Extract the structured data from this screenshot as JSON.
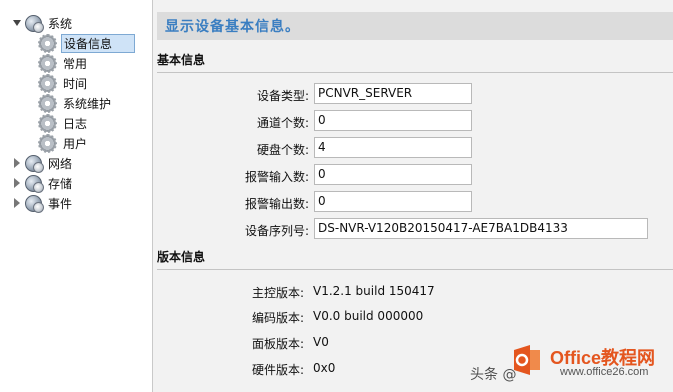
{
  "sidebar": {
    "root_system": "系统",
    "system_children": [
      "设备信息",
      "常用",
      "时间",
      "系统维护",
      "日志",
      "用户"
    ],
    "other_roots": [
      "网络",
      "存储",
      "事件"
    ]
  },
  "main": {
    "title": "显示设备基本信息。",
    "basic_section": "基本信息",
    "fields": [
      {
        "label": "设备类型:",
        "value": "PCNVR_SERVER"
      },
      {
        "label": "通道个数:",
        "value": "0"
      },
      {
        "label": "硬盘个数:",
        "value": "4"
      },
      {
        "label": "报警输入数:",
        "value": "0"
      },
      {
        "label": "报警输出数:",
        "value": "0"
      },
      {
        "label": "设备序列号:",
        "value": "DS-NVR-V120B20150417-AE7BA1DB4133"
      }
    ],
    "version_section": "版本信息",
    "versions": [
      {
        "label": "主控版本:",
        "value": "V1.2.1 build 150417"
      },
      {
        "label": "编码版本:",
        "value": "V0.0 build 000000"
      },
      {
        "label": "面板版本:",
        "value": "V0"
      },
      {
        "label": "硬件版本:",
        "value": "0x0"
      }
    ]
  },
  "watermark": {
    "text": "头条 @",
    "brand": "Office教程网",
    "url": "www.office26.com",
    "logo_letter": "O"
  },
  "colors": {
    "title_text": "#3a7ec1",
    "selected_bg": "#cfe3f7",
    "brand": "#e4561f"
  }
}
